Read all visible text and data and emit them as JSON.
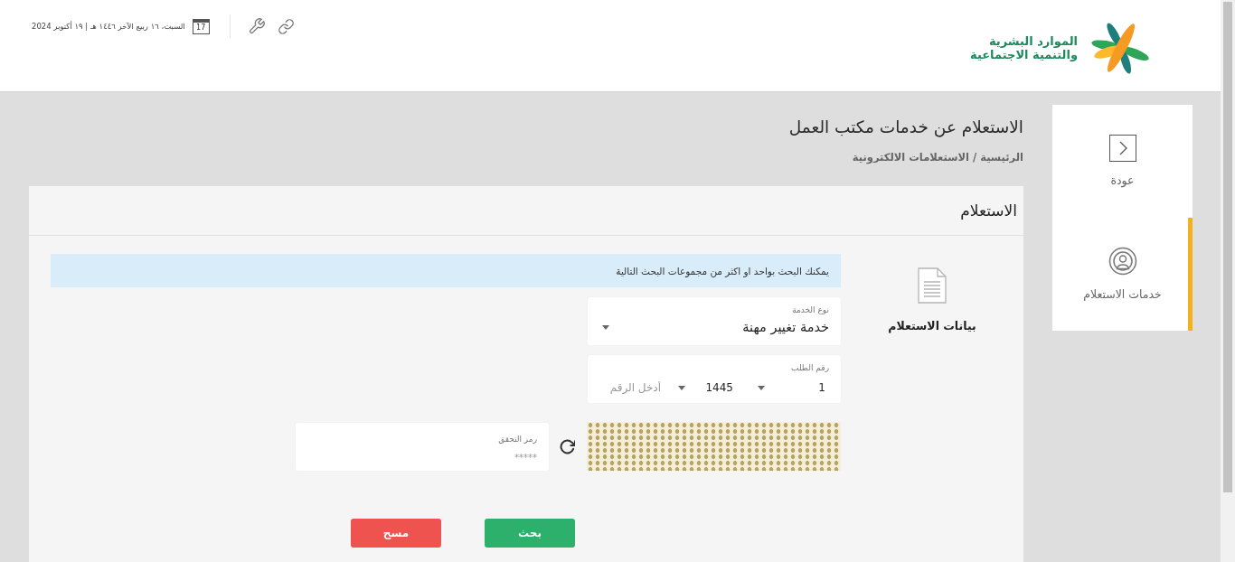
{
  "header": {
    "logo_lines": [
      "الموارد البشرية",
      "والتنمية الاجتماعية"
    ],
    "calendar_day": "17",
    "date": "السبت، ١٦ ربيع الآخر ١٤٤٦ هـ | ١٩ أكتوبر 2024"
  },
  "sidebar": {
    "items": [
      {
        "kind": "back",
        "label": "عودة",
        "selected": false
      },
      {
        "kind": "services",
        "label": "خدمات الاستعلام",
        "selected": true
      }
    ]
  },
  "page": {
    "title": "الاستعلام عن خدمات مكتب العمل",
    "breadcrumb": "الرئيسية / الاستعلامات الالكترونية"
  },
  "card": {
    "title": "الاستعلام",
    "section_label": "بيانات الاستعلام",
    "notice": "يمكنك البحث بواحد او اكثر من مجموعات البحث التالية",
    "service_type": {
      "label": "نوع الخدمة",
      "value": "خدمة تغيير مهنة"
    },
    "request_number": {
      "label": "رقم الطلب",
      "parts": [
        {
          "kind": "select",
          "value": "1"
        },
        {
          "kind": "select",
          "value": "1445"
        },
        {
          "kind": "input",
          "placeholder": "أدخل الرقم"
        }
      ]
    },
    "captcha": {
      "label": "رمز التحقق",
      "placeholder": "*****"
    },
    "buttons": [
      {
        "kind": "search",
        "label": "بحث"
      },
      {
        "kind": "clear",
        "label": "مسح"
      }
    ]
  }
}
